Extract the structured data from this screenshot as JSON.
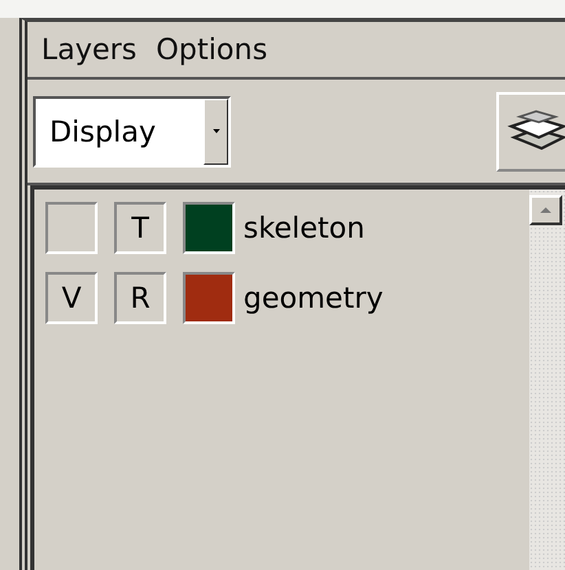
{
  "menu": [
    "Layers",
    "Options"
  ],
  "toolbar": {
    "dropdown": {
      "value": "Display"
    }
  },
  "layers": [
    {
      "type": "T",
      "color": "#004020",
      "name": "skeleton"
    },
    {
      "visibility_label": "V",
      "type": "R",
      "color": "#a02c10",
      "name": "geometry"
    }
  ]
}
